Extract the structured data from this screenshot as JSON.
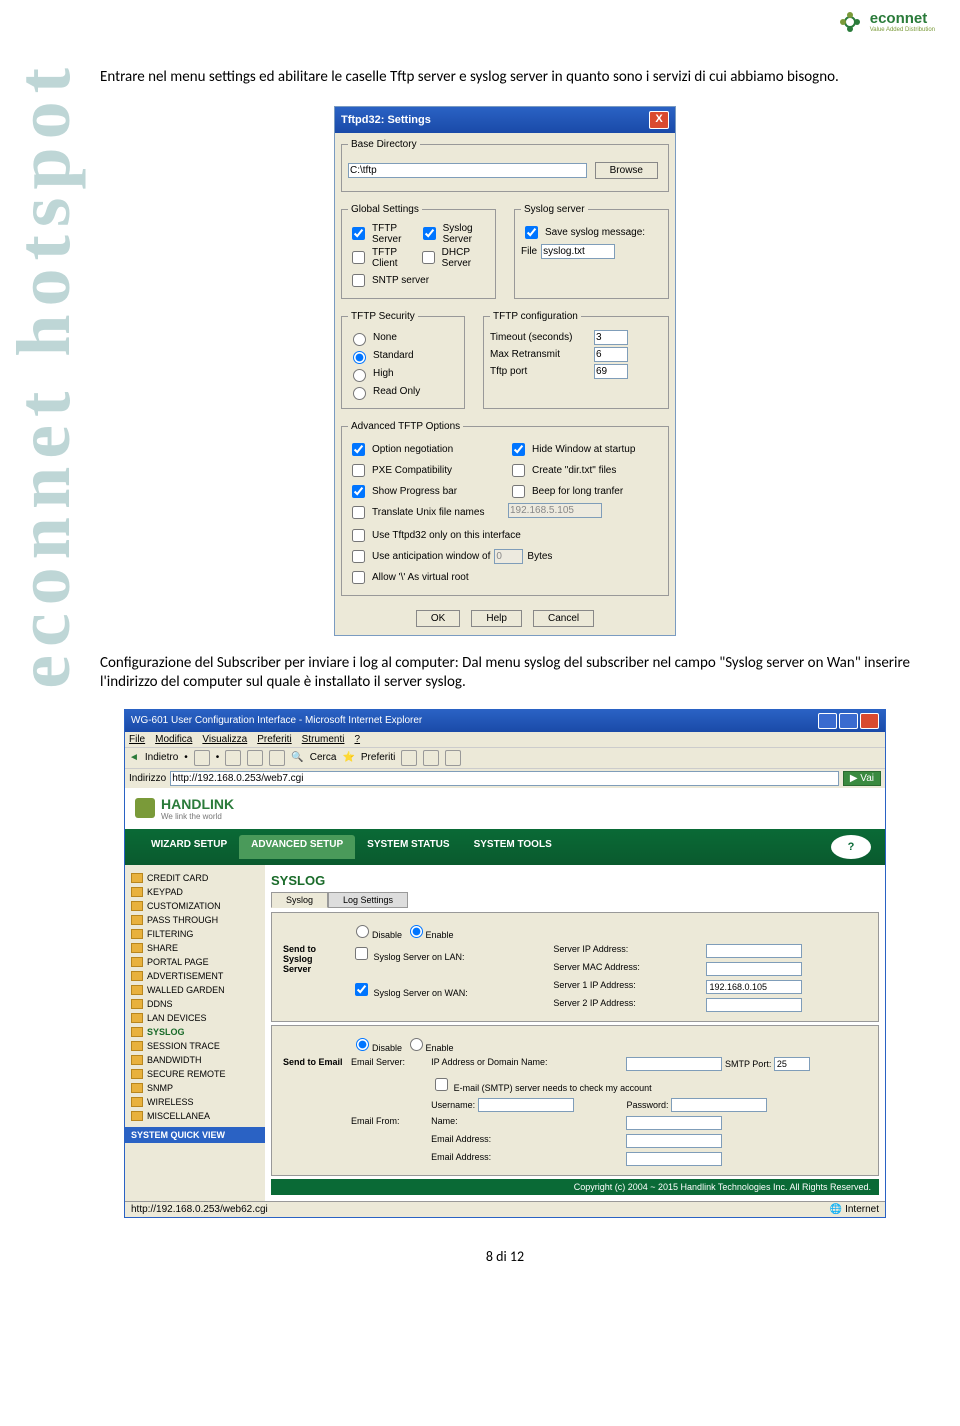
{
  "logo": {
    "brand": "econnet",
    "tagline": "Value Added Distribution"
  },
  "sidebar_text": "econnet hotspot",
  "para1": "Entrare nel menu settings ed abilitare le caselle Tftp server e syslog server in quanto sono i servizi di cui abbiamo bisogno.",
  "para2": "Configurazione del Subscriber per inviare i log al computer: Dal menu syslog del subscriber nel campo \"Syslog server on Wan\" inserire l'indirizzo del computer sul quale è installato il server syslog.",
  "settings": {
    "title": "Tftpd32: Settings",
    "base_dir_label": "Base Directory",
    "base_dir": "C:\\tftp",
    "browse": "Browse",
    "global_label": "Global Settings",
    "tftp_server": "TFTP Server",
    "syslog_server": "Syslog Server",
    "tftp_client": "TFTP Client",
    "dhcp_server": "DHCP Server",
    "sntp_server": "SNTP server",
    "syslog_srv_label": "Syslog server",
    "save_syslog": "Save syslog message:",
    "file_label": "File",
    "file_val": "syslog.txt",
    "security_label": "TFTP Security",
    "none": "None",
    "standard": "Standard",
    "high": "High",
    "readonly": "Read Only",
    "config_label": "TFTP configuration",
    "timeout": "Timeout (seconds)",
    "timeout_v": "3",
    "maxret": "Max Retransmit",
    "maxret_v": "6",
    "port": "Tftp port",
    "port_v": "69",
    "adv_label": "Advanced TFTP Options",
    "opt_neg": "Option negotiation",
    "hide_win": "Hide Window at startup",
    "pxe": "PXE Compatibility",
    "create_dir": "Create \"dir.txt\" files",
    "progress": "Show Progress bar",
    "beep": "Beep for long tranfer",
    "translate": "Translate Unix file names",
    "ip_locked": "192.168.5.105",
    "use_only": "Use Tftpd32 only on this interface",
    "anticipation": "Use anticipation window of",
    "ant_v": "0",
    "bytes": "Bytes",
    "allow_virt": "Allow '\\' As virtual root",
    "ok": "OK",
    "help": "Help",
    "cancel": "Cancel"
  },
  "browser": {
    "title": "WG-601 User Configuration Interface - Microsoft Internet Explorer",
    "menu": [
      "File",
      "Modifica",
      "Visualizza",
      "Preferiti",
      "Strumenti",
      "?"
    ],
    "back": "Indietro",
    "search": "Cerca",
    "fav": "Preferiti",
    "addr_label": "Indirizzo",
    "addr": "http://192.168.0.253/web7.cgi",
    "go": "Vai",
    "tabs": [
      "WIZARD SETUP",
      "ADVANCED SETUP",
      "SYSTEM STATUS",
      "SYSTEM TOOLS"
    ],
    "brand": "HANDLINK",
    "brand_tag": "We link the world",
    "nav": [
      "CREDIT CARD",
      "KEYPAD",
      "CUSTOMIZATION",
      "PASS THROUGH",
      "FILTERING",
      "SHARE",
      "PORTAL PAGE",
      "ADVERTISEMENT",
      "WALLED GARDEN",
      "DDNS",
      "LAN DEVICES",
      "SYSLOG",
      "SESSION TRACE",
      "BANDWIDTH",
      "SECURE REMOTE",
      "SNMP",
      "WIRELESS",
      "MISCELLANEA"
    ],
    "quickview": "SYSTEM QUICK VIEW",
    "page_title": "SYSLOG",
    "subtabs": [
      "Syslog",
      "Log Settings"
    ],
    "disable": "Disable",
    "enable": "Enable",
    "send_syslog": "Send to Syslog Server",
    "lan_label": "Syslog Server on LAN:",
    "wan_label": "Syslog Server on WAN:",
    "s_ip": "Server IP Address:",
    "s_mac": "Server MAC Address:",
    "s1_ip": "Server 1 IP Address:",
    "s1_ip_v": "192.168.0.105",
    "s2_ip": "Server 2 IP Address:",
    "send_email": "Send to Email",
    "email_server": "Email Server:",
    "ip_domain": "IP Address or Domain Name:",
    "smtp_port": "SMTP Port:",
    "smtp_port_v": "25",
    "smtp_check": "E-mail (SMTP) server needs to check my account",
    "user": "Username:",
    "pass": "Password:",
    "email_from": "Email From:",
    "name": "Name:",
    "email_addr": "Email Address:",
    "copyright": "Copyright (c) 2004 ~ 2015 Handlink Technologies Inc. All Rights Reserved.",
    "status_url": "http://192.168.0.253/web62.cgi",
    "status_zone": "Internet"
  },
  "pagenum": "8 di 12"
}
